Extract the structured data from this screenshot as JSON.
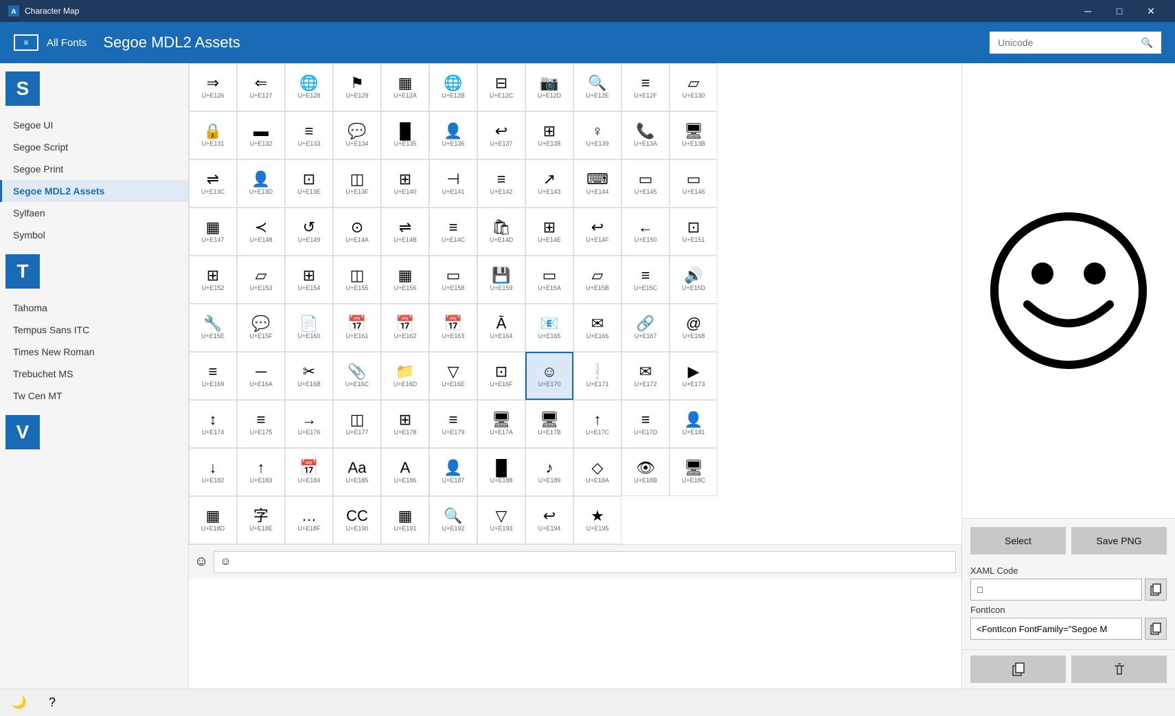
{
  "titleBar": {
    "title": "Character Map",
    "controls": [
      "─",
      "□",
      "✕"
    ]
  },
  "header": {
    "allFonts": "All Fonts",
    "title": "Segoe MDL2 Assets",
    "searchPlaceholder": "Unicode"
  },
  "sidebar": {
    "sLetterHeader": "S",
    "tLetterHeader": "T",
    "vLetterHeader": "V",
    "items": [
      {
        "id": "segoe-ui",
        "label": "Segoe UI",
        "active": false
      },
      {
        "id": "segoe-script",
        "label": "Segoe Script",
        "active": false
      },
      {
        "id": "segoe-print",
        "label": "Segoe Print",
        "active": false
      },
      {
        "id": "segoe-mdl2",
        "label": "Segoe MDL2 Assets",
        "active": true
      },
      {
        "id": "sylfaen",
        "label": "Sylfaen",
        "active": false
      },
      {
        "id": "symbol",
        "label": "Symbol",
        "active": false
      },
      {
        "id": "tahoma",
        "label": "Tahoma",
        "active": false
      },
      {
        "id": "tempus",
        "label": "Tempus Sans ITC",
        "active": false
      },
      {
        "id": "times",
        "label": "Times New Roman",
        "active": false
      },
      {
        "id": "trebuchet",
        "label": "Trebuchet MS",
        "active": false
      },
      {
        "id": "twcen",
        "label": "Tw Cen MT",
        "active": false
      }
    ]
  },
  "characters": [
    {
      "code": "U+E126",
      "entity": "&#xE126;"
    },
    {
      "code": "U+E127",
      "entity": "&#xE127;"
    },
    {
      "code": "U+E128",
      "entity": "&#xE128;"
    },
    {
      "code": "U+E129",
      "entity": "&#xE129;"
    },
    {
      "code": "U+E12A",
      "entity": "&#xE12A;"
    },
    {
      "code": "U+E12B",
      "entity": "&#xE12B;"
    },
    {
      "code": "U+E12C",
      "entity": "&#xE12C;"
    },
    {
      "code": "U+E12D",
      "entity": "&#xE12D;"
    },
    {
      "code": "U+E12E",
      "entity": "&#xE12E;"
    },
    {
      "code": "U+E12F",
      "entity": "&#xE12F;"
    },
    {
      "code": "U+E130",
      "entity": "&#xE130;"
    },
    {
      "code": "U+E131",
      "entity": "&#xE131;"
    },
    {
      "code": "U+E132",
      "entity": "&#xE132;"
    },
    {
      "code": "U+E133",
      "entity": "&#xE133;"
    },
    {
      "code": "U+E134",
      "entity": "&#xE134;"
    },
    {
      "code": "U+E135",
      "entity": "&#xE135;"
    },
    {
      "code": "U+E136",
      "entity": "&#xE136;"
    },
    {
      "code": "U+E137",
      "entity": "&#xE137;"
    },
    {
      "code": "U+E138",
      "entity": "&#xE138;"
    },
    {
      "code": "U+E139",
      "entity": "&#xE139;"
    },
    {
      "code": "U+E13A",
      "entity": "&#xE13A;"
    },
    {
      "code": "U+E13B",
      "entity": "&#xE13B;"
    },
    {
      "code": "U+E13C",
      "entity": "&#xE13C;"
    },
    {
      "code": "U+E13D",
      "entity": "&#xE13D;"
    },
    {
      "code": "U+E13E",
      "entity": "&#xE13E;"
    },
    {
      "code": "U+E13F",
      "entity": "&#xE13F;"
    },
    {
      "code": "U+E140",
      "entity": "&#xE140;"
    },
    {
      "code": "U+E141",
      "entity": "&#xE141;"
    },
    {
      "code": "U+E142",
      "entity": "&#xE142;"
    },
    {
      "code": "U+E143",
      "entity": "&#xE143;"
    },
    {
      "code": "U+E144",
      "entity": "&#xE144;"
    },
    {
      "code": "U+E145",
      "entity": "&#xE145;"
    },
    {
      "code": "U+E146",
      "entity": "&#xE146;"
    },
    {
      "code": "U+E147",
      "entity": "&#xE147;"
    },
    {
      "code": "U+E148",
      "entity": "&#xE148;"
    },
    {
      "code": "U+E149",
      "entity": "&#xE149;"
    },
    {
      "code": "U+E14A",
      "entity": "&#xE14A;"
    },
    {
      "code": "U+E14B",
      "entity": "&#xE14B;"
    },
    {
      "code": "U+E14C",
      "entity": "&#xE14C;"
    },
    {
      "code": "U+E14D",
      "entity": "&#xE14D;"
    },
    {
      "code": "U+E14E",
      "entity": "&#xE14E;"
    },
    {
      "code": "U+E14F",
      "entity": "&#xE14F;"
    },
    {
      "code": "U+E150",
      "entity": "&#xE150;"
    },
    {
      "code": "U+E151",
      "entity": "&#xE151;"
    },
    {
      "code": "U+E152",
      "entity": "&#xE152;"
    },
    {
      "code": "U+E153",
      "entity": "&#xE153;"
    },
    {
      "code": "U+E154",
      "entity": "&#xE154;"
    },
    {
      "code": "U+E155",
      "entity": "&#xE155;"
    },
    {
      "code": "U+E156",
      "entity": "&#xE156;"
    },
    {
      "code": "U+E158",
      "entity": "&#xE158;"
    },
    {
      "code": "U+E159",
      "entity": "&#xE159;"
    },
    {
      "code": "U+E15A",
      "entity": "&#xE15A;"
    },
    {
      "code": "U+E15B",
      "entity": "&#xE15B;"
    },
    {
      "code": "U+E15C",
      "entity": "&#xE15C;"
    },
    {
      "code": "U+E15D",
      "entity": "&#xE15D;"
    },
    {
      "code": "U+E15E",
      "entity": "&#xE15E;"
    },
    {
      "code": "U+E15F",
      "entity": "&#xE15F;"
    },
    {
      "code": "U+E160",
      "entity": "&#xE160;"
    },
    {
      "code": "U+E161",
      "entity": "&#xE161;"
    },
    {
      "code": "U+E162",
      "entity": "&#xE162;"
    },
    {
      "code": "U+E163",
      "entity": "&#xE163;"
    },
    {
      "code": "U+E164",
      "entity": "&#xE164;"
    },
    {
      "code": "U+E165",
      "entity": "&#xE165;"
    },
    {
      "code": "U+E166",
      "entity": "&#xE166;"
    },
    {
      "code": "U+E167",
      "entity": "&#xE167;"
    },
    {
      "code": "U+E168",
      "entity": "&#xE168;"
    },
    {
      "code": "U+E169",
      "entity": "&#xE169;"
    },
    {
      "code": "U+E16A",
      "entity": "&#xE16A;"
    },
    {
      "code": "U+E16B",
      "entity": "&#xE16B;"
    },
    {
      "code": "U+E16C",
      "entity": "&#xE16C;"
    },
    {
      "code": "U+E16D",
      "entity": "&#xE16D;"
    },
    {
      "code": "U+E16E",
      "entity": "&#xE16E;"
    },
    {
      "code": "U+E16F",
      "entity": "&#xE16F;"
    },
    {
      "code": "U+E170",
      "entity": "&#xE170;",
      "selected": true
    },
    {
      "code": "U+E171",
      "entity": "&#xE171;"
    },
    {
      "code": "U+E172",
      "entity": "&#xE172;"
    },
    {
      "code": "U+E173",
      "entity": "&#xE173;"
    },
    {
      "code": "U+E174",
      "entity": "&#xE174;"
    },
    {
      "code": "U+E175",
      "entity": "&#xE175;"
    },
    {
      "code": "U+E176",
      "entity": "&#xE176;"
    },
    {
      "code": "U+E177",
      "entity": "&#xE177;"
    },
    {
      "code": "U+E178",
      "entity": "&#xE178;"
    },
    {
      "code": "U+E179",
      "entity": "&#xE179;"
    },
    {
      "code": "U+E17A",
      "entity": "&#xE17A;"
    },
    {
      "code": "U+E17B",
      "entity": "&#xE17B;"
    },
    {
      "code": "U+E17C",
      "entity": "&#xE17C;"
    },
    {
      "code": "U+E17D",
      "entity": "&#xE17D;"
    },
    {
      "code": "U+E181",
      "entity": "&#xE181;"
    },
    {
      "code": "U+E182",
      "entity": "&#xE182;"
    },
    {
      "code": "U+E183",
      "entity": "&#xE183;"
    },
    {
      "code": "U+E184",
      "entity": "&#xE184;"
    },
    {
      "code": "U+E185",
      "entity": "&#xE185;"
    },
    {
      "code": "U+E186",
      "entity": "&#xE186;"
    },
    {
      "code": "U+E187",
      "entity": "&#xE187;"
    },
    {
      "code": "U+E188",
      "entity": "&#xE188;"
    },
    {
      "code": "U+E189",
      "entity": "&#xE189;"
    },
    {
      "code": "U+E18A",
      "entity": "&#xE18A;"
    },
    {
      "code": "U+E18B",
      "entity": "&#xE18B;"
    },
    {
      "code": "U+E18C",
      "entity": "&#xE18C;"
    },
    {
      "code": "U+E18D",
      "entity": "&#xE18D;"
    },
    {
      "code": "U+E18E",
      "entity": "&#xE18E;"
    },
    {
      "code": "U+E18F",
      "entity": "&#xE18F;"
    },
    {
      "code": "U+E190",
      "entity": "&#xE190;"
    },
    {
      "code": "U+E191",
      "entity": "&#xE191;"
    },
    {
      "code": "U+E192",
      "entity": "&#xE192;"
    },
    {
      "code": "U+E193",
      "entity": "&#xE193;"
    },
    {
      "code": "U+E194",
      "entity": "&#xE194;"
    },
    {
      "code": "U+E195",
      "entity": "&#xE195;"
    }
  ],
  "selectedChar": {
    "entity": "&#xE170;",
    "symbol": "☺",
    "unicode": "U+E170"
  },
  "rightPanel": {
    "selectLabel": "Select",
    "savePngLabel": "Save PNG",
    "xamlCodeLabel": "XAML Code",
    "xamlValue": "&#xE170;",
    "fontIconLabel": "FontIcon",
    "fontIconValue": "<FontIcon FontFamily=\"Segoe M"
  },
  "bottomBar": {
    "inputValue": "☺"
  },
  "statusBar": {
    "nightModeIcon": "🌙",
    "helpIcon": "?"
  }
}
